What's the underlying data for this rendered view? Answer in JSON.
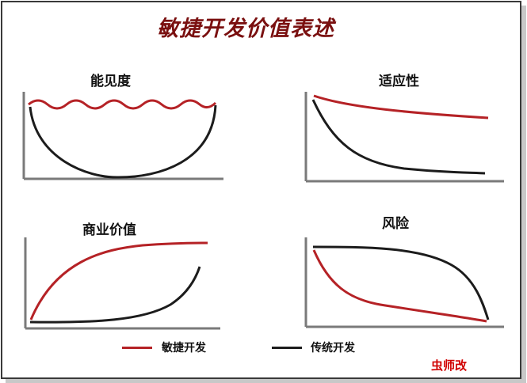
{
  "title": "敏捷开发价值表述",
  "panels": [
    {
      "key": "visibility",
      "title": "能见度"
    },
    {
      "key": "adaptability",
      "title": "适应性"
    },
    {
      "key": "business_value",
      "title": "商业价值"
    },
    {
      "key": "risk",
      "title": "风险"
    }
  ],
  "legend": [
    {
      "label": "敏捷开发",
      "color": "#b52226"
    },
    {
      "label": "传统开发",
      "color": "#1c1c1c"
    }
  ],
  "credit": "虫师改",
  "colors": {
    "agile": "#b52226",
    "traditional": "#1c1c1c",
    "axis": "#7a7a7a",
    "title": "#7a1010"
  }
}
